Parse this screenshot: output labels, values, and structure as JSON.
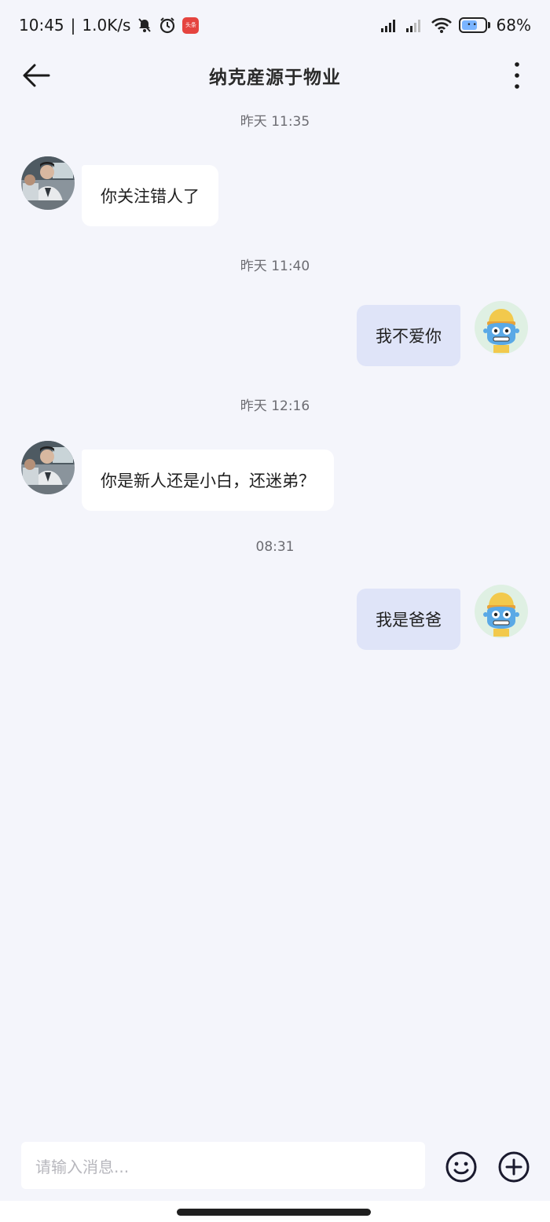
{
  "status_bar": {
    "time": "10:45",
    "speed": "1.0K/s",
    "app_badge": "头条",
    "battery": "68%",
    "battery_level": 0.68
  },
  "header": {
    "title": "纳克産源于物业"
  },
  "messages": [
    {
      "timestamp": "昨天 11:35",
      "side": "left",
      "text": "你关注错人了"
    },
    {
      "timestamp": "昨天 11:40",
      "side": "right",
      "text": "我不爱你"
    },
    {
      "timestamp": "昨天 12:16",
      "side": "left",
      "text": "你是新人还是小白，还迷弟？"
    },
    {
      "timestamp": "08:31",
      "side": "right",
      "text": "我是爸爸"
    }
  ],
  "composer": {
    "placeholder": "请输入消息..."
  },
  "icons": {
    "back": "arrow-left-icon",
    "more": "more-vertical-icon",
    "emoji": "smiley-icon",
    "plus": "plus-circle-icon"
  },
  "colors": {
    "background": "#f4f5fb",
    "outgoing_bubble": "#dfe4f8",
    "incoming_bubble": "#ffffff"
  }
}
